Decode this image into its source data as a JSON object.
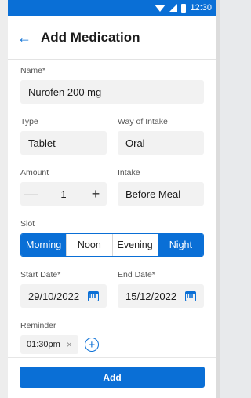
{
  "status_bar": {
    "time": "12:30",
    "icons": [
      "wifi-icon",
      "signal-icon",
      "battery-icon"
    ],
    "color": "#0a6fd6"
  },
  "app_bar": {
    "back_icon": "arrow-left-icon",
    "back_glyph": "←",
    "title": "Add Medication"
  },
  "form": {
    "name": {
      "label": "Name*",
      "value": "Nurofen 200 mg"
    },
    "type": {
      "label": "Type",
      "value": "Tablet"
    },
    "way_of_intake": {
      "label": "Way of Intake",
      "value": "Oral"
    },
    "amount": {
      "label": "Amount",
      "value": "1",
      "minus": "—",
      "plus": "+"
    },
    "intake": {
      "label": "Intake",
      "value": "Before Meal"
    },
    "slot": {
      "label": "Slot",
      "options": [
        "Morning",
        "Noon",
        "Evening",
        "Night"
      ],
      "selected": [
        "Morning",
        "Night"
      ]
    },
    "start_date": {
      "label": "Start Date*",
      "value": "29/10/2022",
      "icon": "calendar-icon"
    },
    "end_date": {
      "label": "End Date*",
      "value": "15/12/2022",
      "icon": "calendar-icon"
    },
    "reminder": {
      "label": "Reminder",
      "chips": [
        {
          "time": "01:30pm",
          "remove": "×"
        }
      ],
      "add": "+"
    }
  },
  "footer": {
    "add_label": "Add"
  },
  "colors": {
    "accent": "#0a6fd6",
    "field_bg": "#f2f2f2"
  }
}
